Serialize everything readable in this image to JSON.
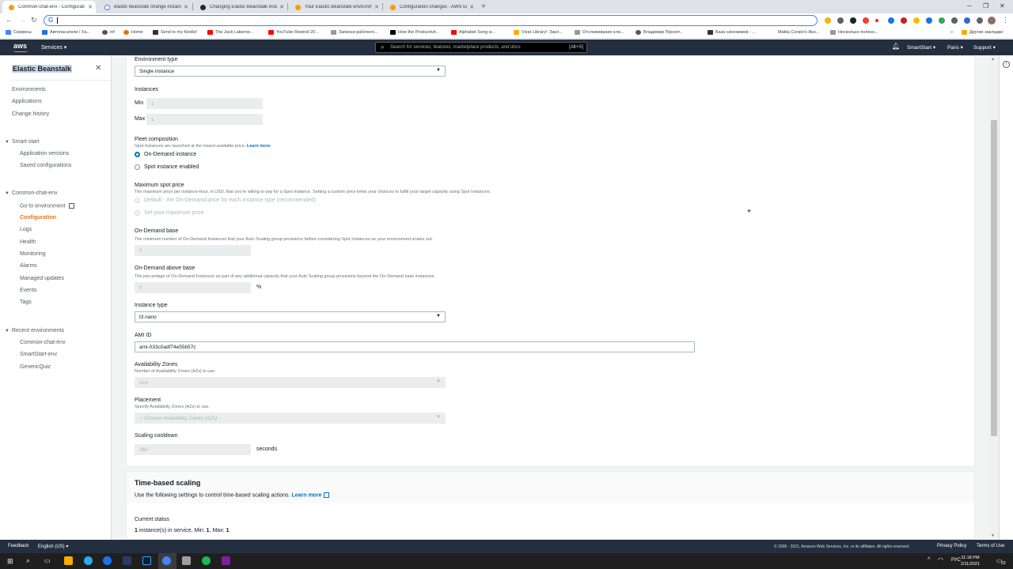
{
  "browser": {
    "tabs": [
      {
        "title": "Common-chat-env - Configurati",
        "color": "#ff9900"
      },
      {
        "title": "elastic beanstalk change instanc",
        "color": "#4285f4"
      },
      {
        "title": "Changing Elastic Beanstalk insta",
        "color": "#24292e"
      },
      {
        "title": "Your Elastic Beanstalk environme",
        "color": "#ff9900"
      },
      {
        "title": "Configuration changes - AWS Ela",
        "color": "#ff9900"
      }
    ],
    "omnibox_value": "",
    "bookmarks": [
      {
        "label": "Сервисы",
        "color": "#4285f4"
      },
      {
        "label": "Автопасатели / Ха...",
        "color": "#1a73e8"
      },
      {
        "label": "inf",
        "color": "#555"
      },
      {
        "label": "Home",
        "color": "#e8710a"
      },
      {
        "label": "Send to my Kindle!",
        "color": "#333"
      },
      {
        "label": "The Jack Laberne...",
        "color": "#ff0000"
      },
      {
        "label": "YouTube Rewind 20...",
        "color": "#ff0000"
      },
      {
        "label": "Записки рабочего...",
        "color": "#999"
      },
      {
        "label": "How the Productivit...",
        "color": "#000"
      },
      {
        "label": "Alphabet Song w...",
        "color": "#ff0000"
      },
      {
        "label": "Vivat Library!: Закл...",
        "color": "#f9ab00"
      },
      {
        "label": "Отслеживание кли...",
        "color": "#999"
      },
      {
        "label": "Владимир Пронят...",
        "color": "#555"
      },
      {
        "label": "База синонимов - ...",
        "color": "#333"
      },
      {
        "label": "Mattia Cerato's illus...",
        "color": "#aaa"
      },
      {
        "label": "Несколько полезн...",
        "color": "#999"
      }
    ],
    "other_bookmarks": "Другие закладки"
  },
  "aws_header": {
    "logo": "aws",
    "services": "Services",
    "search_placeholder": "Search for services, features, marketplace products, and docs",
    "search_shortcut": "[Alt+S]",
    "account": "SmartStart",
    "region": "Paris",
    "support": "Support"
  },
  "sidebar": {
    "title": "Elastic Beanstalk",
    "top_links": [
      "Environments",
      "Applications",
      "Change history"
    ],
    "app_name": "Smart-start",
    "app_links": [
      "Application versions",
      "Saved configurations"
    ],
    "env_name": "Common-chat-env",
    "env_links": [
      "Go to environment",
      "Configuration",
      "Logs",
      "Health",
      "Monitoring",
      "Alarms",
      "Managed updates",
      "Events",
      "Tags"
    ],
    "recent_heading": "Recent environments",
    "recent_links": [
      "Common-chat-env",
      "SmartStart-env",
      "GenericQuiz"
    ]
  },
  "form": {
    "env_type_label": "Environment type",
    "env_type_value": "Single instance",
    "instances_label": "Instances",
    "min_label": "Min",
    "min_value": "1",
    "max_label": "Max",
    "max_value": "1",
    "fleet_label": "Fleet composition",
    "fleet_desc": "Spot Instances are launched at the lowest available price.",
    "learn_more": "Learn more",
    "fleet_options": [
      "On-Demand instance",
      "Spot instance enabled"
    ],
    "max_spot_label": "Maximum spot price",
    "max_spot_desc": "The maximum price per instance-hour, in USD, that you're willing to pay for a Spot Instance. Setting a custom price limits your chances to fulfill your target capacity using Spot Instances.",
    "max_spot_options": [
      "Default - the On-Demand price for each instance type (recommended)",
      "Set your maximum price"
    ],
    "od_base_label": "On-Demand base",
    "od_base_desc": "The minimum number of On-Demand Instances that your Auto Scaling group provisions before considering Spot Instances as your environment scales out.",
    "od_base_value": "0",
    "od_above_label": "On-Demand above base",
    "od_above_desc": "The percentage of On-Demand Instances as part of any additional capacity that your Auto Scaling group provisions beyond the On-Demand base instances.",
    "od_above_value": "0",
    "od_above_unit": "%",
    "instance_type_label": "Instance type",
    "instance_type_value": "t3.nano",
    "ami_label": "AMI ID",
    "ami_value": "ami-033c0adf74e55b57c",
    "az_label": "Availability Zones",
    "az_desc": "Number of Availability Zones (AZs) to use.",
    "az_value": "Any",
    "placement_label": "Placement",
    "placement_desc": "Specify Availability Zones (AZs) to use.",
    "placement_value": "-- Choose Availability Zones (AZs) --",
    "cooldown_label": "Scaling cooldown",
    "cooldown_value": "360",
    "cooldown_unit": "seconds"
  },
  "time_scaling": {
    "title": "Time-based scaling",
    "desc": "Use the following settings to control time-based scaling actions.",
    "learn_more": "Learn more",
    "status_label": "Current status",
    "status_num": "1",
    "status_text": " instance(s) in service, Min: ",
    "status_min": "1",
    "status_text2": ", Max: ",
    "status_max": "1"
  },
  "footer": {
    "feedback": "Feedback",
    "language": "English (US)",
    "copyright": "© 2008 - 2021, Amazon Web Services, Inc. or its affiliates. All rights reserved.",
    "privacy": "Privacy Policy",
    "terms": "Terms of Use"
  },
  "taskbar": {
    "lang": "РУС",
    "time": "11:18 PM",
    "date": "2/11/2021",
    "notif": "23"
  }
}
